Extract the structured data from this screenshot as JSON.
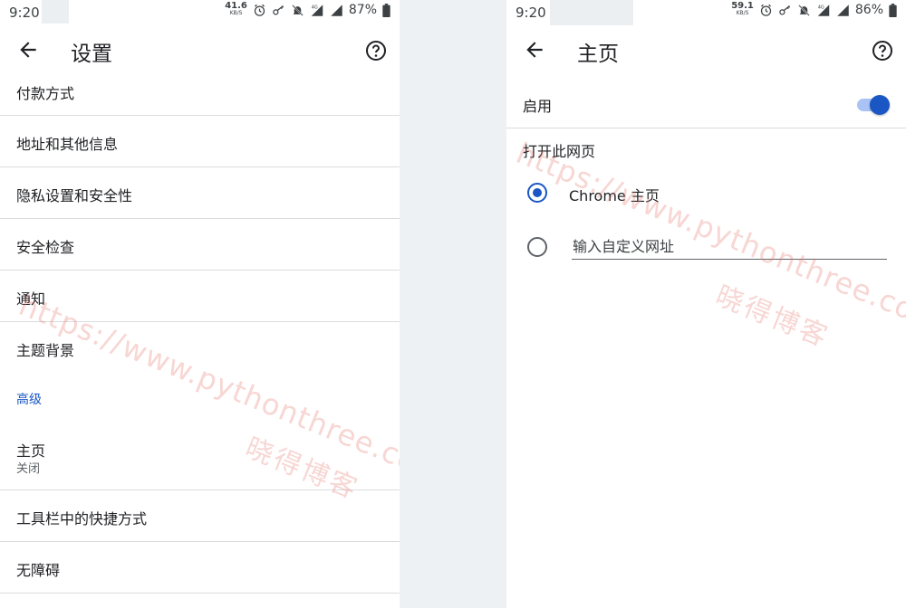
{
  "left": {
    "status": {
      "time": "9:20",
      "net_speed": "41.6",
      "net_unit": "KB/S",
      "battery": "87%"
    },
    "title": "设置",
    "rows": [
      {
        "label": "付款方式"
      },
      {
        "label": "地址和其他信息"
      },
      {
        "label": "隐私设置和安全性"
      },
      {
        "label": "安全检查"
      },
      {
        "label": "通知"
      },
      {
        "label": "主题背景"
      }
    ],
    "section": "高级",
    "homepage": {
      "label": "主页",
      "sub": "关闭"
    },
    "rows2": [
      {
        "label": "工具栏中的快捷方式"
      },
      {
        "label": "无障碍"
      }
    ]
  },
  "right": {
    "status": {
      "time": "9:20",
      "net_speed": "59.1",
      "net_unit": "KB/S",
      "battery": "86%"
    },
    "title": "主页",
    "enable_label": "启用",
    "enabled": true,
    "section": "打开此网页",
    "option1": "Chrome 主页",
    "option2_placeholder": "输入自定义网址"
  },
  "watermark": {
    "url": "https://www.pythonthree.com",
    "name": "晓得博客"
  },
  "colors": {
    "accent": "#1a57c4",
    "divider": "#dadce0",
    "gutter": "#eef1f4"
  },
  "icons": [
    "back-arrow-icon",
    "help-icon",
    "alarm-icon",
    "key-icon",
    "mute-bell-icon",
    "signal-4g-icon",
    "signal-icon",
    "battery-icon"
  ]
}
